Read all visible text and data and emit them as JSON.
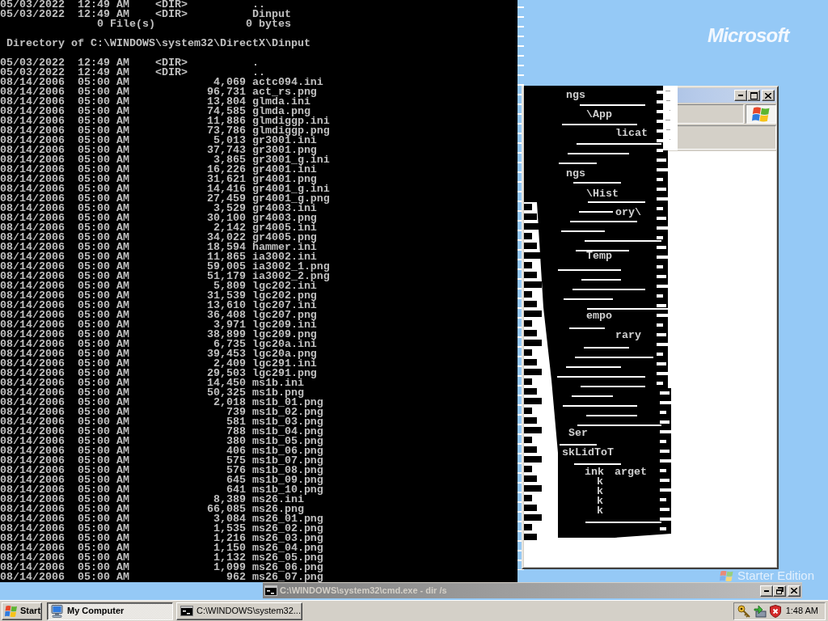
{
  "desktop": {
    "logo": "Microsoft",
    "edition": "Starter Edition"
  },
  "console": {
    "lines": [
      {
        "kind": "dir",
        "date": "05/03/2022",
        "time": "12:49 AM",
        "type": "<DIR>",
        "name": ".."
      },
      {
        "kind": "dir",
        "date": "05/03/2022",
        "time": "12:49 AM",
        "type": "<DIR>",
        "name": "Dinput"
      },
      {
        "kind": "summary",
        "files": "0 File(s)",
        "bytes": "0 bytes"
      },
      {
        "kind": "blank"
      },
      {
        "kind": "heading",
        "text": "Directory of C:\\WINDOWS\\system32\\DirectX\\Dinput"
      },
      {
        "kind": "blank"
      },
      {
        "kind": "dir",
        "date": "05/03/2022",
        "time": "12:49 AM",
        "type": "<DIR>",
        "name": "."
      },
      {
        "kind": "dir",
        "date": "05/03/2022",
        "time": "12:49 AM",
        "type": "<DIR>",
        "name": ".."
      },
      {
        "kind": "file",
        "date": "08/14/2006",
        "time": "05:00 AM",
        "size": "4,069",
        "name": "actc094.ini"
      },
      {
        "kind": "file",
        "date": "08/14/2006",
        "time": "05:00 AM",
        "size": "96,731",
        "name": "act_rs.png"
      },
      {
        "kind": "file",
        "date": "08/14/2006",
        "time": "05:00 AM",
        "size": "13,804",
        "name": "glmda.ini"
      },
      {
        "kind": "file",
        "date": "08/14/2006",
        "time": "05:00 AM",
        "size": "74,585",
        "name": "glmda.png"
      },
      {
        "kind": "file",
        "date": "08/14/2006",
        "time": "05:00 AM",
        "size": "11,886",
        "name": "glmdiggp.ini"
      },
      {
        "kind": "file",
        "date": "08/14/2006",
        "time": "05:00 AM",
        "size": "73,786",
        "name": "glmdiggp.png"
      },
      {
        "kind": "file",
        "date": "08/14/2006",
        "time": "05:00 AM",
        "size": "5,013",
        "name": "gr3001.ini"
      },
      {
        "kind": "file",
        "date": "08/14/2006",
        "time": "05:00 AM",
        "size": "37,743",
        "name": "gr3001.png"
      },
      {
        "kind": "file",
        "date": "08/14/2006",
        "time": "05:00 AM",
        "size": "3,865",
        "name": "gr3001_g.ini"
      },
      {
        "kind": "file",
        "date": "08/14/2006",
        "time": "05:00 AM",
        "size": "16,226",
        "name": "gr4001.ini"
      },
      {
        "kind": "file",
        "date": "08/14/2006",
        "time": "05:00 AM",
        "size": "31,621",
        "name": "gr4001.png"
      },
      {
        "kind": "file",
        "date": "08/14/2006",
        "time": "05:00 AM",
        "size": "14,416",
        "name": "gr4001_g.ini"
      },
      {
        "kind": "file",
        "date": "08/14/2006",
        "time": "05:00 AM",
        "size": "27,459",
        "name": "gr4001_g.png"
      },
      {
        "kind": "file",
        "date": "08/14/2006",
        "time": "05:00 AM",
        "size": "3,529",
        "name": "gr4003.ini"
      },
      {
        "kind": "file",
        "date": "08/14/2006",
        "time": "05:00 AM",
        "size": "30,100",
        "name": "gr4003.png"
      },
      {
        "kind": "file",
        "date": "08/14/2006",
        "time": "05:00 AM",
        "size": "2,142",
        "name": "gr4005.ini"
      },
      {
        "kind": "file",
        "date": "08/14/2006",
        "time": "05:00 AM",
        "size": "34,022",
        "name": "gr4005.png"
      },
      {
        "kind": "file",
        "date": "08/14/2006",
        "time": "05:00 AM",
        "size": "18,594",
        "name": "hammer.ini"
      },
      {
        "kind": "file",
        "date": "08/14/2006",
        "time": "05:00 AM",
        "size": "11,865",
        "name": "ia3002.ini"
      },
      {
        "kind": "file",
        "date": "08/14/2006",
        "time": "05:00 AM",
        "size": "59,005",
        "name": "ia3002_1.png"
      },
      {
        "kind": "file",
        "date": "08/14/2006",
        "time": "05:00 AM",
        "size": "51,179",
        "name": "ia3002_2.png"
      },
      {
        "kind": "file",
        "date": "08/14/2006",
        "time": "05:00 AM",
        "size": "5,809",
        "name": "lgc202.ini"
      },
      {
        "kind": "file",
        "date": "08/14/2006",
        "time": "05:00 AM",
        "size": "31,539",
        "name": "lgc202.png"
      },
      {
        "kind": "file",
        "date": "08/14/2006",
        "time": "05:00 AM",
        "size": "13,610",
        "name": "lgc207.ini"
      },
      {
        "kind": "file",
        "date": "08/14/2006",
        "time": "05:00 AM",
        "size": "36,408",
        "name": "lgc207.png"
      },
      {
        "kind": "file",
        "date": "08/14/2006",
        "time": "05:00 AM",
        "size": "3,971",
        "name": "lgc209.ini"
      },
      {
        "kind": "file",
        "date": "08/14/2006",
        "time": "05:00 AM",
        "size": "38,899",
        "name": "lgc209.png"
      },
      {
        "kind": "file",
        "date": "08/14/2006",
        "time": "05:00 AM",
        "size": "6,735",
        "name": "lgc20a.ini"
      },
      {
        "kind": "file",
        "date": "08/14/2006",
        "time": "05:00 AM",
        "size": "39,453",
        "name": "lgc20a.png"
      },
      {
        "kind": "file",
        "date": "08/14/2006",
        "time": "05:00 AM",
        "size": "2,409",
        "name": "lgc291.ini"
      },
      {
        "kind": "file",
        "date": "08/14/2006",
        "time": "05:00 AM",
        "size": "29,503",
        "name": "lgc291.png"
      },
      {
        "kind": "file",
        "date": "08/14/2006",
        "time": "05:00 AM",
        "size": "14,450",
        "name": "ms1b.ini"
      },
      {
        "kind": "file",
        "date": "08/14/2006",
        "time": "05:00 AM",
        "size": "50,325",
        "name": "ms1b.png"
      },
      {
        "kind": "file",
        "date": "08/14/2006",
        "time": "05:00 AM",
        "size": "2,018",
        "name": "ms1b_01.png"
      },
      {
        "kind": "file",
        "date": "08/14/2006",
        "time": "05:00 AM",
        "size": "739",
        "name": "ms1b_02.png"
      },
      {
        "kind": "file",
        "date": "08/14/2006",
        "time": "05:00 AM",
        "size": "581",
        "name": "ms1b_03.png"
      },
      {
        "kind": "file",
        "date": "08/14/2006",
        "time": "05:00 AM",
        "size": "788",
        "name": "ms1b_04.png"
      },
      {
        "kind": "file",
        "date": "08/14/2006",
        "time": "05:00 AM",
        "size": "380",
        "name": "ms1b_05.png"
      },
      {
        "kind": "file",
        "date": "08/14/2006",
        "time": "05:00 AM",
        "size": "406",
        "name": "ms1b_06.png"
      },
      {
        "kind": "file",
        "date": "08/14/2006",
        "time": "05:00 AM",
        "size": "575",
        "name": "ms1b_07.png"
      },
      {
        "kind": "file",
        "date": "08/14/2006",
        "time": "05:00 AM",
        "size": "576",
        "name": "ms1b_08.png"
      },
      {
        "kind": "file",
        "date": "08/14/2006",
        "time": "05:00 AM",
        "size": "645",
        "name": "ms1b_09.png"
      },
      {
        "kind": "file",
        "date": "08/14/2006",
        "time": "05:00 AM",
        "size": "641",
        "name": "ms1b_10.png"
      },
      {
        "kind": "file",
        "date": "08/14/2006",
        "time": "05:00 AM",
        "size": "8,389",
        "name": "ms26.ini"
      },
      {
        "kind": "file",
        "date": "08/14/2006",
        "time": "05:00 AM",
        "size": "66,085",
        "name": "ms26.png"
      },
      {
        "kind": "file",
        "date": "08/14/2006",
        "time": "05:00 AM",
        "size": "3,084",
        "name": "ms26_01.png"
      },
      {
        "kind": "file",
        "date": "08/14/2006",
        "time": "05:00 AM",
        "size": "1,535",
        "name": "ms26_02.png"
      },
      {
        "kind": "file",
        "date": "08/14/2006",
        "time": "05:00 AM",
        "size": "1,216",
        "name": "ms26_03.png"
      },
      {
        "kind": "file",
        "date": "08/14/2006",
        "time": "05:00 AM",
        "size": "1,150",
        "name": "ms26_04.png"
      },
      {
        "kind": "file",
        "date": "08/14/2006",
        "time": "05:00 AM",
        "size": "1,132",
        "name": "ms26_05.png"
      },
      {
        "kind": "file",
        "date": "08/14/2006",
        "time": "05:00 AM",
        "size": "1,099",
        "name": "ms26_06.png"
      },
      {
        "kind": "file",
        "date": "08/14/2006",
        "time": "05:00 AM",
        "size": "962",
        "name": "ms26_07.png"
      }
    ]
  },
  "glitch_fragments": [
    {
      "text": "ngs"
    },
    {
      "text": "\\App"
    },
    {
      "text": "licat"
    },
    {
      "text": "ngs"
    },
    {
      "text": "\\Hist"
    },
    {
      "text": "ory\\"
    },
    {
      "text": "Temp"
    },
    {
      "text": "empo"
    },
    {
      "text": "rary"
    },
    {
      "text": "Ser"
    },
    {
      "text": "skLidToT"
    },
    {
      "text": "ink"
    },
    {
      "text": "arget"
    },
    {
      "text": "k"
    },
    {
      "text": "k"
    },
    {
      "text": "k"
    },
    {
      "text": "k"
    }
  ],
  "console_title_bar": {
    "title": "C:\\WINDOWS\\system32\\cmd.exe - dir /s"
  },
  "taskbar": {
    "start": "Start",
    "buttons": [
      {
        "kind": "explorer",
        "label": "My Computer",
        "selected": true
      },
      {
        "kind": "console",
        "label": "C:\\WINDOWS\\system32...",
        "selected": false
      }
    ],
    "clock": "1:48 AM"
  }
}
